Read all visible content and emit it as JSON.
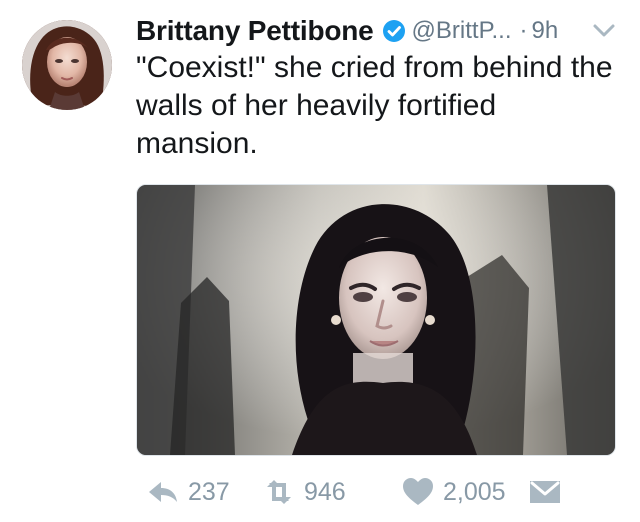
{
  "tweet": {
    "display_name": "Brittany Pettibone",
    "handle": "@BrittP...",
    "dot": "·",
    "time": "9h",
    "text": "\"Coexist!\" she cried from behind the\nwalls of her heavily fortified\nmansion."
  },
  "actions": {
    "replies": "237",
    "retweets": "946",
    "likes": "2,005"
  },
  "icons": {
    "verified": "verified-badge-icon",
    "caret": "chevron-down-icon",
    "reply": "reply-icon",
    "retweet": "retweet-icon",
    "like": "heart-icon",
    "dm": "direct-message-icon"
  },
  "colors": {
    "primary_text": "#14171a",
    "secondary_text": "#657786",
    "action_gray": "#8899a6",
    "verified_blue": "#1da1f2"
  }
}
